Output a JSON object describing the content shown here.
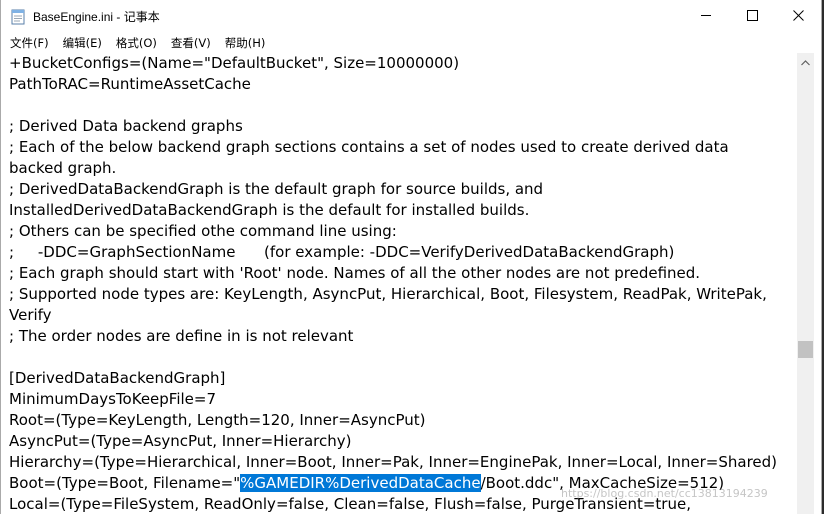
{
  "window": {
    "title": "BaseEngine.ini - 记事本",
    "icon": "notepad-icon",
    "controls": [
      "minimize-icon",
      "maximize-icon",
      "close-icon"
    ]
  },
  "menu": {
    "items": [
      "文件(F)",
      "编辑(E)",
      "格式(O)",
      "查看(V)",
      "帮助(H)"
    ]
  },
  "editor": {
    "lines": [
      {
        "text": "+BucketConfigs=(Name=\"DefaultBucket\", Size=10000000)"
      },
      {
        "text": "PathToRAC=RuntimeAssetCache"
      },
      {
        "text": ""
      },
      {
        "text": "; Derived Data backend graphs"
      },
      {
        "text": "; Each of the below backend graph sections contains a set of nodes used to create derived data"
      },
      {
        "text": "backed graph."
      },
      {
        "text": "; DerivedDataBackendGraph is the default graph for source builds, and"
      },
      {
        "text": "InstalledDerivedDataBackendGraph is the default for installed builds."
      },
      {
        "text": "; Others can be specified othe command line using:"
      },
      {
        "text": ";     -DDC=GraphSectionName      (for example: -DDC=VerifyDerivedDataBackendGraph)"
      },
      {
        "text": "; Each graph should start with 'Root' node. Names of all the other nodes are not predefined."
      },
      {
        "text": "; Supported node types are: KeyLength, AsyncPut, Hierarchical, Boot, Filesystem, ReadPak, WritePak,"
      },
      {
        "text": "Verify"
      },
      {
        "text": "; The order nodes are define in is not relevant"
      },
      {
        "text": ""
      },
      {
        "text": "[DerivedDataBackendGraph]"
      },
      {
        "text": "MinimumDaysToKeepFile=7"
      },
      {
        "text": "Root=(Type=KeyLength, Length=120, Inner=AsyncPut)"
      },
      {
        "text": "AsyncPut=(Type=AsyncPut, Inner=Hierarchy)"
      },
      {
        "text": "Hierarchy=(Type=Hierarchical, Inner=Boot, Inner=Pak, Inner=EnginePak, Inner=Local, Inner=Shared)"
      },
      {
        "before": "Boot=(Type=Boot, Filename=\"",
        "selected": "%GAMEDIR%DerivedDataCache",
        "after": "/Boot.ddc\", MaxCacheSize=512)"
      },
      {
        "text": "Local=(Type=FileSystem, ReadOnly=false, Clean=false, Flush=false, PurgeTransient=true,"
      }
    ]
  },
  "watermark": "https://blog.csdn.net/cc13813194239"
}
